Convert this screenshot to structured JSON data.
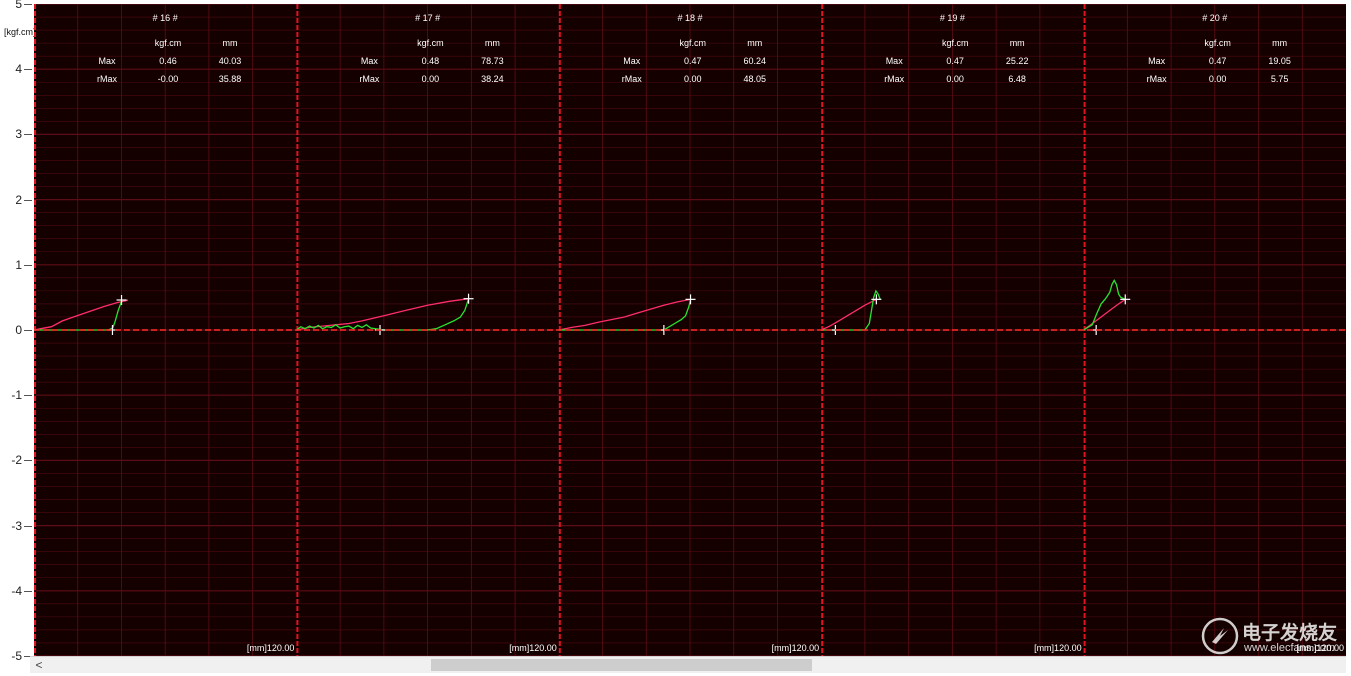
{
  "y_unit": "[kgf.cm]",
  "colors": {
    "background": "#150000",
    "grid": "#5c0d16",
    "separator": "#e3131d",
    "zero_line": "#ff2a2a",
    "forward_curve": "#ff2d6b",
    "return_curve": "#28e32e",
    "marker": "#ffffff",
    "text": "#ffffff"
  },
  "scrollbar": {
    "left_arrow": "<"
  },
  "watermark": {
    "text": "电子发烧友",
    "url": "www.elecfans.com"
  },
  "chart_data": {
    "type": "line",
    "ylim": [
      -5,
      5
    ],
    "yticks": [
      "5",
      "4",
      "3",
      "2",
      "1",
      "0",
      "-1",
      "-2",
      "-3",
      "-4",
      "-5"
    ],
    "xlim": [
      0,
      120
    ],
    "grid": true,
    "panels": [
      {
        "title": "# 16 #",
        "header": [
          "kgf.cm",
          "mm"
        ],
        "rows": [
          {
            "label": "Max",
            "kgf": "0.46",
            "mm": "40.03"
          },
          {
            "label": "rMax",
            "kgf": "-0.00",
            "mm": "35.88"
          }
        ],
        "x_end_label": "[mm]120.00",
        "series": [
          {
            "x": [
              0,
              3,
              8,
              13,
              18,
              25,
              32,
              38,
              42,
              43
            ],
            "y": [
              0,
              0.02,
              0.05,
              0.14,
              0.2,
              0.28,
              0.36,
              0.42,
              0.45,
              0.46
            ]
          },
          {
            "x": [
              0,
              20,
              34,
              36,
              37,
              38.5,
              40,
              40.03
            ],
            "y": [
              0,
              0,
              0,
              0.03,
              0.12,
              0.3,
              0.44,
              0.46
            ]
          }
        ],
        "markers": [
          {
            "x": 40.03,
            "y": 0.46
          },
          {
            "x": 35.88,
            "y": 0.0
          }
        ]
      },
      {
        "title": "# 17 #",
        "header": [
          "kgf.cm",
          "mm"
        ],
        "rows": [
          {
            "label": "Max",
            "kgf": "0.48",
            "mm": "78.73"
          },
          {
            "label": "rMax",
            "kgf": "0.00",
            "mm": "38.24"
          }
        ],
        "x_end_label": "[mm]120.00",
        "series": [
          {
            "x": [
              0,
              6,
              12,
              18,
              24,
              30,
              40,
              50,
              60,
              70,
              78.73
            ],
            "y": [
              0,
              0.04,
              0.06,
              0.08,
              0.1,
              0.14,
              0.22,
              0.3,
              0.38,
              0.44,
              0.48
            ]
          },
          {
            "x": [
              0,
              2,
              4,
              6,
              8,
              10,
              12,
              14,
              16,
              18,
              20,
              22,
              24,
              26,
              28,
              30,
              32,
              34,
              36,
              40,
              50,
              60,
              64,
              68,
              72,
              75,
              77,
              78.73
            ],
            "y": [
              0,
              0.05,
              0.02,
              0.06,
              0.03,
              0.07,
              0.02,
              0.05,
              0.04,
              0.08,
              0.03,
              0.05,
              0.06,
              0.02,
              0.07,
              0.04,
              0.08,
              0.03,
              0.02,
              0,
              0,
              0,
              0.02,
              0.08,
              0.14,
              0.2,
              0.3,
              0.48
            ]
          }
        ],
        "markers": [
          {
            "x": 78.73,
            "y": 0.48
          },
          {
            "x": 38.24,
            "y": 0.0
          }
        ]
      },
      {
        "title": "# 18 #",
        "header": [
          "kgf.cm",
          "mm"
        ],
        "rows": [
          {
            "label": "Max",
            "kgf": "0.47",
            "mm": "60.24"
          },
          {
            "label": "rMax",
            "kgf": "0.00",
            "mm": "48.05"
          }
        ],
        "x_end_label": "[mm]120.00",
        "series": [
          {
            "x": [
              0,
              6,
              12,
              18,
              24,
              30,
              36,
              42,
              48,
              54,
              60.24
            ],
            "y": [
              0,
              0.04,
              0.07,
              0.12,
              0.16,
              0.2,
              0.26,
              0.32,
              0.38,
              0.43,
              0.47
            ]
          },
          {
            "x": [
              0,
              30,
              48.05,
              50,
              53,
              56,
              58,
              59.5,
              60.24
            ],
            "y": [
              0,
              0,
              0,
              0.04,
              0.1,
              0.16,
              0.22,
              0.36,
              0.47
            ]
          }
        ],
        "markers": [
          {
            "x": 60.24,
            "y": 0.47
          },
          {
            "x": 48.05,
            "y": 0.0
          }
        ]
      },
      {
        "title": "# 19 #",
        "header": [
          "kgf.cm",
          "mm"
        ],
        "rows": [
          {
            "label": "Max",
            "kgf": "0.47",
            "mm": "25.22"
          },
          {
            "label": "rMax",
            "kgf": "0.00",
            "mm": "6.48"
          }
        ],
        "x_end_label": "[mm]120.00",
        "series": [
          {
            "x": [
              0,
              4,
              8,
              12,
              16,
              20,
              25.22
            ],
            "y": [
              0,
              0.06,
              0.14,
              0.22,
              0.3,
              0.38,
              0.47
            ]
          },
          {
            "x": [
              0,
              10,
              20,
              22,
              23,
              24,
              25,
              26,
              27
            ],
            "y": [
              0,
              0,
              0,
              0.1,
              0.3,
              0.5,
              0.6,
              0.55,
              0.47
            ]
          }
        ],
        "markers": [
          {
            "x": 25.22,
            "y": 0.47
          },
          {
            "x": 6.48,
            "y": 0.0
          }
        ]
      },
      {
        "title": "# 20 #",
        "header": [
          "kgf.cm",
          "mm"
        ],
        "rows": [
          {
            "label": "Max",
            "kgf": "0.47",
            "mm": "19.05"
          },
          {
            "label": "rMax",
            "kgf": "0.00",
            "mm": "5.75"
          }
        ],
        "x_end_label": "[mm]120.00",
        "series": [
          {
            "x": [
              0,
              4,
              8,
              12,
              16,
              19.05
            ],
            "y": [
              0,
              0.1,
              0.2,
              0.3,
              0.4,
              0.47
            ]
          },
          {
            "x": [
              0,
              4,
              6,
              8,
              10,
              12,
              13,
              14,
              15,
              16,
              17,
              19.05
            ],
            "y": [
              0,
              0.08,
              0.25,
              0.4,
              0.48,
              0.58,
              0.7,
              0.76,
              0.7,
              0.55,
              0.5,
              0.47
            ]
          }
        ],
        "markers": [
          {
            "x": 19.05,
            "y": 0.47
          },
          {
            "x": 5.75,
            "y": 0.0
          }
        ]
      }
    ]
  }
}
